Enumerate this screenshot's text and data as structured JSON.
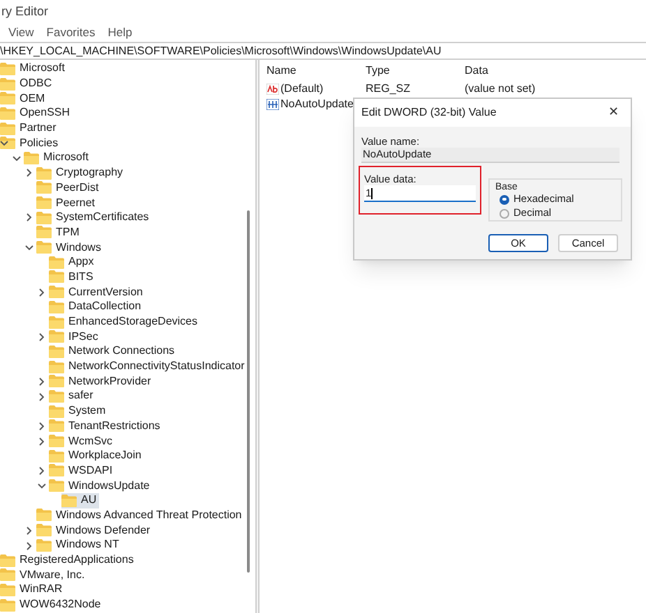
{
  "window": {
    "title": "ry Editor"
  },
  "menu": [
    "View",
    "Favorites",
    "Help"
  ],
  "address": "\\HKEY_LOCAL_MACHINE\\SOFTWARE\\Policies\\Microsoft\\Windows\\WindowsUpdate\\AU",
  "tree": [
    {
      "label": "Microsoft",
      "selected": false
    },
    {
      "label": "ODBC",
      "selected": false
    },
    {
      "label": "OEM",
      "selected": false
    },
    {
      "label": "OpenSSH",
      "selected": false
    },
    {
      "label": "Partner",
      "selected": false
    },
    {
      "label": "Policies",
      "selected": false,
      "expanded": true,
      "children": [
        {
          "label": "Microsoft",
          "selected": false,
          "expanded": true,
          "children": [
            {
              "label": "Cryptography",
              "selected": false,
              "expanded": false
            },
            {
              "label": "PeerDist",
              "selected": false
            },
            {
              "label": "Peernet",
              "selected": false
            },
            {
              "label": "SystemCertificates",
              "selected": false,
              "expanded": false
            },
            {
              "label": "TPM",
              "selected": false
            },
            {
              "label": "Windows",
              "selected": false,
              "expanded": true,
              "children": [
                {
                  "label": "Appx",
                  "selected": false
                },
                {
                  "label": "BITS",
                  "selected": false
                },
                {
                  "label": "CurrentVersion",
                  "selected": false,
                  "expanded": false
                },
                {
                  "label": "DataCollection",
                  "selected": false
                },
                {
                  "label": "EnhancedStorageDevices",
                  "selected": false
                },
                {
                  "label": "IPSec",
                  "selected": false,
                  "expanded": false
                },
                {
                  "label": "Network Connections",
                  "selected": false
                },
                {
                  "label": "NetworkConnectivityStatusIndicator",
                  "selected": false
                },
                {
                  "label": "NetworkProvider",
                  "selected": false,
                  "expanded": false
                },
                {
                  "label": "safer",
                  "selected": false,
                  "expanded": false
                },
                {
                  "label": "System",
                  "selected": false
                },
                {
                  "label": "TenantRestrictions",
                  "selected": false,
                  "expanded": false
                },
                {
                  "label": "WcmSvc",
                  "selected": false,
                  "expanded": false
                },
                {
                  "label": "WorkplaceJoin",
                  "selected": false
                },
                {
                  "label": "WSDAPI",
                  "selected": false,
                  "expanded": false
                },
                {
                  "label": "WindowsUpdate",
                  "selected": false,
                  "expanded": true,
                  "children": [
                    {
                      "label": "AU",
                      "selected": true
                    }
                  ]
                }
              ]
            },
            {
              "label": "Windows Advanced Threat Protection",
              "selected": false
            },
            {
              "label": "Windows Defender",
              "selected": false,
              "expanded": false
            },
            {
              "label": "Windows NT",
              "selected": false,
              "expanded": false
            }
          ]
        }
      ]
    },
    {
      "label": "RegisteredApplications",
      "selected": false
    },
    {
      "label": "VMware, Inc.",
      "selected": false
    },
    {
      "label": "WinRAR",
      "selected": false
    },
    {
      "label": "WOW6432Node",
      "selected": false
    }
  ],
  "values": {
    "columns": [
      "Name",
      "Type",
      "Data"
    ],
    "rows": [
      {
        "kind": "string",
        "name": "(Default)",
        "type": "REG_SZ",
        "data": "(value not set)"
      },
      {
        "kind": "binary",
        "name": "NoAutoUpdate"
      }
    ]
  },
  "dialog": {
    "title": "Edit DWORD (32-bit) Value",
    "close": "✕",
    "value_name_label": "Value name:",
    "value_name": "NoAutoUpdate",
    "value_data_label": "Value data:",
    "value_data": "1",
    "base_label": "Base",
    "bases": [
      {
        "label": "Hexadecimal",
        "selected": true
      },
      {
        "label": "Decimal",
        "selected": false
      }
    ],
    "buttons": [
      "OK",
      "Cancel"
    ]
  }
}
